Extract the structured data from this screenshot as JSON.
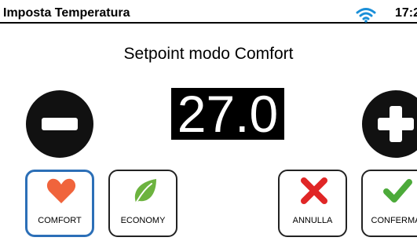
{
  "header": {
    "title": "Imposta Temperatura",
    "time": "17:2",
    "wifi_icon": "wifi-icon",
    "wifi_color": "#1a8fd8"
  },
  "subtitle": "Setpoint modo Comfort",
  "setpoint": {
    "value": "27.0",
    "decrease_icon": "minus-icon",
    "increase_icon": "plus-icon"
  },
  "buttons": {
    "comfort": {
      "label": "COMFORT",
      "icon": "heart-icon",
      "color": "#f0643c",
      "selected": true
    },
    "economy": {
      "label": "ECONOMY",
      "icon": "leaf-icon",
      "color": "#6cb33f"
    },
    "annulla": {
      "label": "ANNULLA",
      "icon": "cross-icon",
      "color": "#e02626"
    },
    "conferma": {
      "label": "CONFERMA",
      "icon": "check-icon",
      "color": "#4caa3a"
    }
  },
  "colors": {
    "selected_border": "#2c6fb7"
  }
}
